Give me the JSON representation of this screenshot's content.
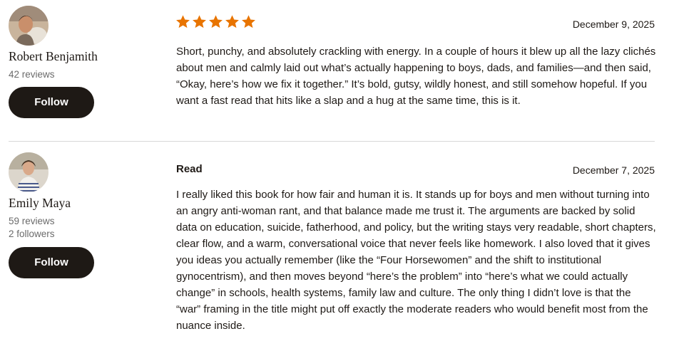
{
  "reviews": [
    {
      "reviewer": {
        "name": "Robert Benjamith",
        "reviews_count": "42 reviews",
        "follow_label": "Follow"
      },
      "rating": 5,
      "star_color": "#e87400",
      "date": "December 9, 2025",
      "text": "Short, punchy, and absolutely crackling with energy. In a couple of hours it blew up all the lazy clichés about men and calmly laid out what’s actually happening to boys, dads, and families—and then said, “Okay, here’s how we fix it together.” It’s bold, gutsy, wildly honest, and still somehow hopeful. If you want a fast read that hits like a slap and a hug at the same time, this is it."
    },
    {
      "reviewer": {
        "name": "Emily Maya",
        "reviews_count": "59 reviews",
        "followers": "2 followers",
        "follow_label": "Follow"
      },
      "shelf_label": "Read",
      "date": "December 7, 2025",
      "text": "I really liked this book for how fair and human it is. It stands up for boys and men without turning into an angry anti-woman rant, and that balance made me trust it. The arguments are backed by solid data on education, suicide, fatherhood, and policy, but the writing stays very readable, short chapters, clear flow, and a warm, conversational voice that never feels like homework. I also loved that it gives you ideas you actually remember (like the “Four Horsewomen” and the shift to institutional gynocentrism), and then moves beyond “here’s the problem” into “here’s what we could actually change” in schools, health systems, family law and culture. The only thing I didn’t love is that the “war” framing in the title might put off exactly the moderate readers who would benefit most from the nuance inside."
    }
  ]
}
